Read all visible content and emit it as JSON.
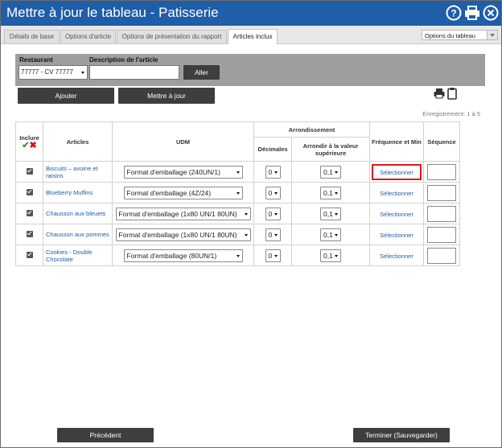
{
  "title": "Mettre à jour le tableau - Patisserie",
  "tabs": [
    {
      "label": "Détails de base"
    },
    {
      "label": "Options d'article"
    },
    {
      "label": "Options de présentation du rapport"
    },
    {
      "label": "Articles inclus",
      "active": true
    }
  ],
  "options_dropdown": {
    "value": "Options du tableau"
  },
  "filter": {
    "restaurant_label": "Restaurant",
    "restaurant_value": "77777 - CV 77777",
    "description_label": "Description de l'article",
    "description_value": "",
    "go_label": "Aller"
  },
  "actions": {
    "add_label": "Ajouter",
    "update_label": "Mettre à jour"
  },
  "record_text": "Enregistrement: 1 à 5",
  "table": {
    "headers": {
      "inclure": "Inclure",
      "articles": "Articles",
      "udm": "UDM",
      "arrondissement": "Arrondissement",
      "decimales": "Décimales",
      "arrondir": "Arrondir à la valeur supérieure",
      "frequence": "Fréquence et Min",
      "sequence": "Séquence"
    },
    "rows": [
      {
        "checked": true,
        "article": "Biscuits – avoine et raisins",
        "udm": "Format d'emballage (240UN/1)",
        "decimales": "0",
        "arrondir": "0,1",
        "frequence": "Sélectionner",
        "sequence": ""
      },
      {
        "checked": true,
        "article": "Blueberry Muffins",
        "udm": "Format d'emballage (4Z/24)",
        "decimales": "0",
        "arrondir": "0,1",
        "frequence": "Sélectionner",
        "sequence": ""
      },
      {
        "checked": true,
        "article": "Chausson aux bleuets",
        "udm": "Format d'emballage (1x80 UN/1 80UN)",
        "decimales": "0",
        "arrondir": "0,1",
        "frequence": "Sélectionner",
        "sequence": ""
      },
      {
        "checked": true,
        "article": "Chausson aux pommes",
        "udm": "Format d'emballage (1x80 UN/1 80UN)",
        "decimales": "0",
        "arrondir": "0,1",
        "frequence": "Sélectionner",
        "sequence": ""
      },
      {
        "checked": true,
        "article": "Cookies - Double Chocolate",
        "udm": "Format d'emballage (80UN/1)",
        "decimales": "0",
        "arrondir": "0,1",
        "frequence": "Sélectionner",
        "sequence": ""
      }
    ]
  },
  "footer": {
    "previous_label": "Précédent",
    "finish_label": "Terminer (Sauvegarder)"
  },
  "colors": {
    "titlebar": "#1f5ea8",
    "link": "#1f5ea8",
    "highlight": "#e0161c",
    "dark_button": "#3e3e3e"
  }
}
